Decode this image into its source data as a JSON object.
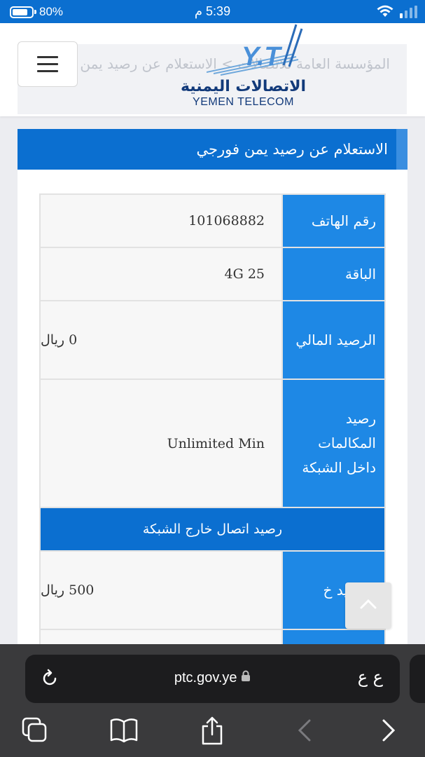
{
  "status_bar": {
    "battery_percent": "80%",
    "battery_level": 0.8,
    "time": "5:39 م"
  },
  "header": {
    "breadcrumb": "المؤسسة العامة للاتصالات > الاستعلام عن رصيد يمن فورجي",
    "logo_mark": "Y.T",
    "logo_arabic": "الاتصالات اليمنية",
    "logo_english": "YEMEN TELECOM"
  },
  "page": {
    "title": "الاستعلام عن رصيد يمن فورجي",
    "rows": [
      {
        "label": "رقم الهاتف",
        "value": "101068882"
      },
      {
        "label": "الباقة",
        "value": "4G 25"
      },
      {
        "label": "الرصيد المالي",
        "value": "0 ريال"
      },
      {
        "label": "رصيد المكالمات داخل الشبكة",
        "value": "Unlimited Min"
      }
    ],
    "section_title": "رصيد اتصال خارج الشبكة",
    "rows2": [
      {
        "label": "الرصيد خ",
        "value": "500 ريال"
      }
    ]
  },
  "browser": {
    "url": "ptc.gov.ye",
    "text_size_button": "ع ع"
  },
  "icons": {
    "wifi": "wifi-icon",
    "signal": "signal-icon",
    "lock": "lock-icon",
    "reload": "reload-icon",
    "tabs": "tabs-icon",
    "bookmarks": "book-icon",
    "share": "share-icon",
    "back": "chevron-left-icon",
    "forward": "chevron-right-icon",
    "scroll_top": "chevron-up-icon"
  },
  "colors": {
    "primary": "#0b6fd0",
    "label_cell": "#1e88e5",
    "logo": "#123a7a"
  }
}
